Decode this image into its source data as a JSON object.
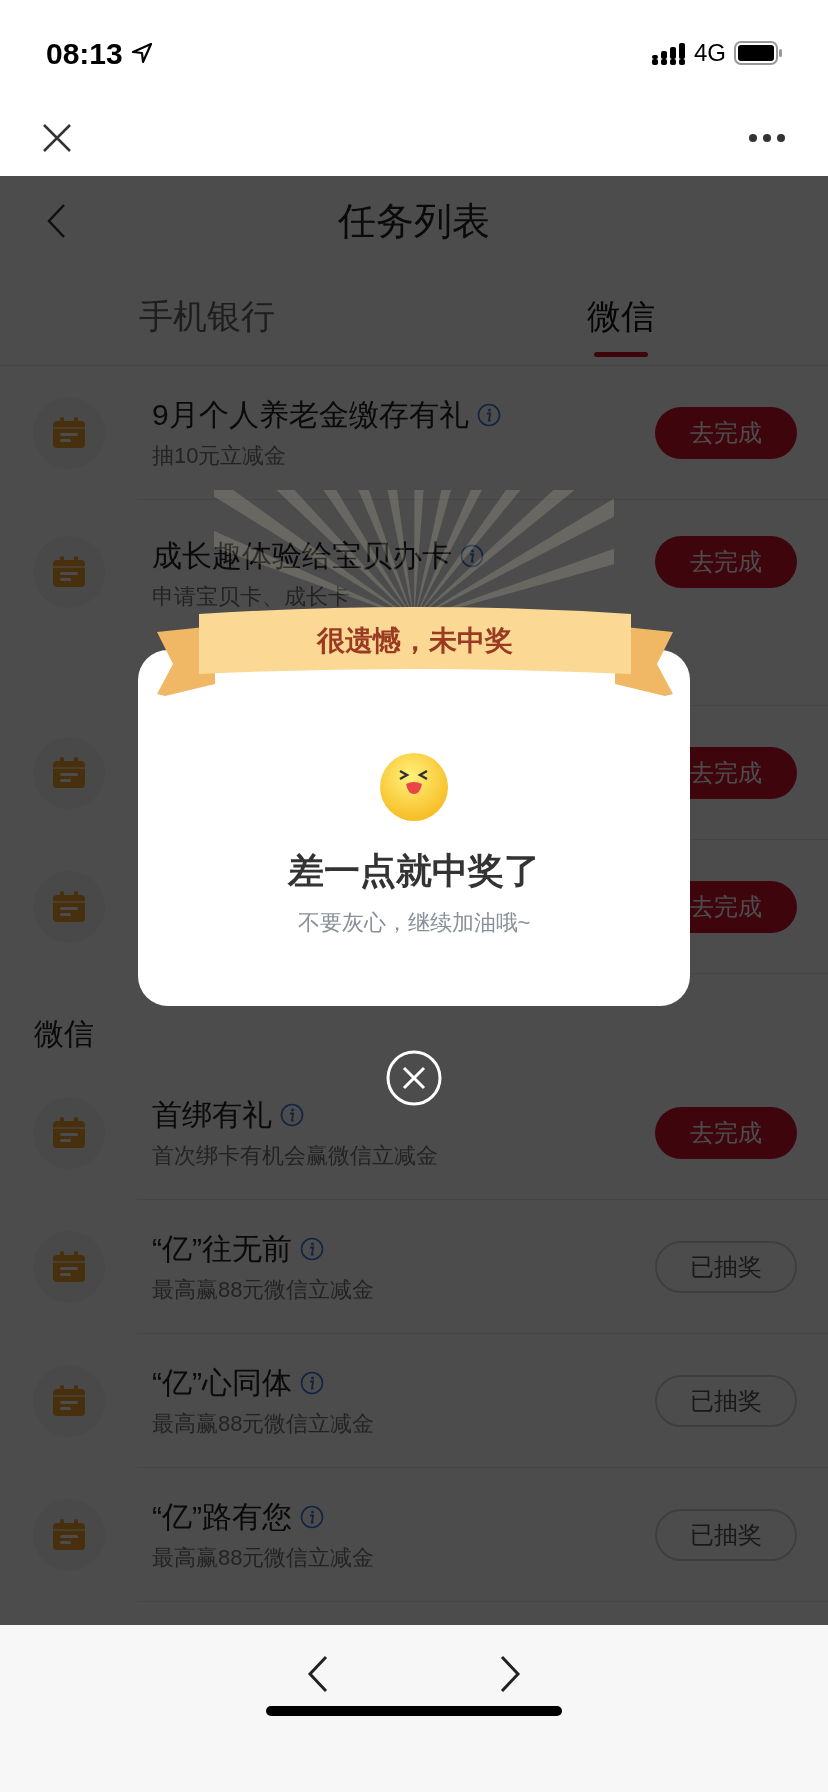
{
  "status_bar": {
    "time": "08:13",
    "network": "4G"
  },
  "page": {
    "title": "任务列表",
    "tabs": [
      {
        "label": "手机银行",
        "selected": false
      },
      {
        "label": "微信",
        "selected": true
      }
    ],
    "tasks": [
      {
        "title": "9月个人养老金缴存有礼",
        "subtitle": "抽10元立减金",
        "action": {
          "label": "去完成",
          "kind": "todo"
        }
      },
      {
        "title": "成长趣体验给宝贝办卡",
        "subtitle": "申请宝贝卡、成长卡",
        "action": {
          "label": "去完成",
          "kind": "todo"
        }
      },
      {
        "action": {
          "label": "去完成",
          "kind": "todo"
        }
      },
      {
        "action": {
          "label": "去完成",
          "kind": "todo"
        }
      }
    ],
    "wechat_section": {
      "heading": "微信",
      "tasks": [
        {
          "title": "首绑有礼",
          "subtitle": "首次绑卡有机会赢微信立减金",
          "action": {
            "label": "去完成",
            "kind": "todo"
          }
        },
        {
          "title": "“亿”往无前",
          "subtitle": "最高赢88元微信立减金",
          "action": {
            "label": "已抽奖",
            "kind": "done"
          }
        },
        {
          "title": "“亿”心同体",
          "subtitle": "最高赢88元微信立减金",
          "action": {
            "label": "已抽奖",
            "kind": "done"
          }
        },
        {
          "title": "“亿”路有您",
          "subtitle": "最高赢88元微信立减金",
          "action": {
            "label": "已抽奖",
            "kind": "done"
          }
        }
      ]
    }
  },
  "dialog": {
    "ribbon": "很遗憾，未中奖",
    "title": "差一点就中奖了",
    "message": "不要灰心，继续加油哦~"
  }
}
